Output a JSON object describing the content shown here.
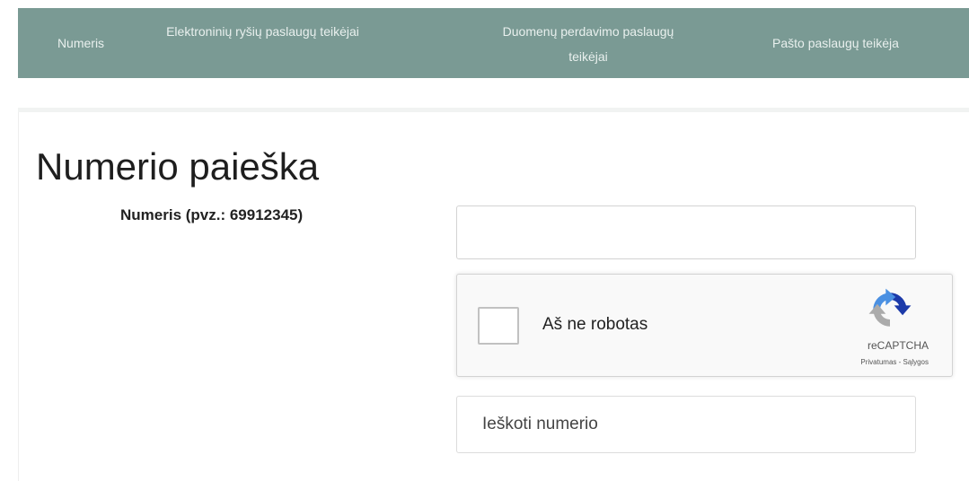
{
  "nav": {
    "items": [
      {
        "label": "Numeris"
      },
      {
        "label": "Elektroninių ryšių paslaugų teikėjai"
      },
      {
        "label": "Duomenų perdavimo paslaugų teikėjai"
      },
      {
        "label": "Pašto paslaugų teikėja"
      }
    ],
    "color": "#7a9a94"
  },
  "main": {
    "title": "Numerio paieška",
    "number_field": {
      "label": "Numeris (pvz.: 69912345)",
      "value": "",
      "placeholder": ""
    },
    "captcha": {
      "label": "Aš ne robotas",
      "brand": "reCAPTCHA",
      "links": "Privatumas - Sąlygos",
      "checked": false
    },
    "search_button": {
      "label": "Ieškoti numerio"
    }
  }
}
